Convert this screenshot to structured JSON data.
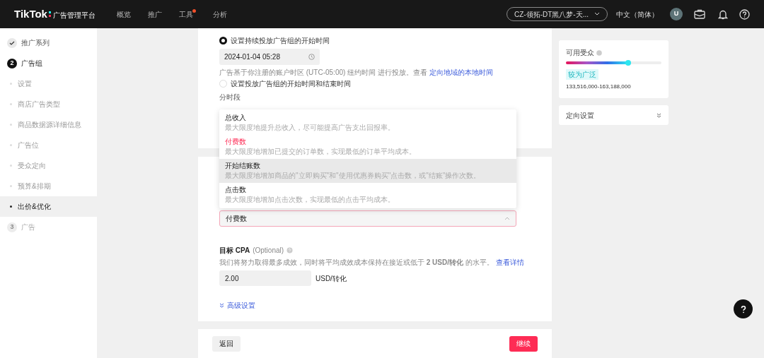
{
  "header": {
    "logo": "TikTok",
    "logo_suffix": "广告管理平台",
    "nav": [
      {
        "label": "概览",
        "badge": false
      },
      {
        "label": "推广",
        "badge": false
      },
      {
        "label": "工具",
        "badge": true
      },
      {
        "label": "分析",
        "badge": false
      }
    ],
    "account": "CZ-领拓-DT黑八梦-天...",
    "language": "中文（简体）",
    "avatar": "U"
  },
  "sidebar": [
    {
      "kind": "step",
      "done": true,
      "current": false,
      "label": "推广系列"
    },
    {
      "kind": "step",
      "done": false,
      "current": true,
      "number": "2",
      "label": "广告组"
    },
    {
      "kind": "sub",
      "label": "设置",
      "selected": false
    },
    {
      "kind": "sub",
      "label": "商店广告类型",
      "selected": false
    },
    {
      "kind": "sub",
      "label": "商品数据源详细信息",
      "selected": false
    },
    {
      "kind": "sub",
      "label": "广告位",
      "selected": false
    },
    {
      "kind": "sub",
      "label": "受众定向",
      "selected": false
    },
    {
      "kind": "sub",
      "label": "预算&排期",
      "selected": false
    },
    {
      "kind": "sub",
      "label": "出价&优化",
      "selected": true
    },
    {
      "kind": "step",
      "done": false,
      "current": false,
      "number": "3",
      "label": "广告"
    }
  ],
  "schedule": {
    "options": [
      {
        "label": "设置持续投放广告组的开始时间",
        "selected": true
      },
      {
        "label": "设置投放广告组的开始时间和结束时间",
        "selected": false
      }
    ],
    "start_time": "2024-01-04 05:28",
    "note": "广告基于你注册的账户时区 (UTC-05:00) 纽约时间 进行投放。查看",
    "note_link": "定向地域的本地时间",
    "dayparting_label": "分时段"
  },
  "optimization": {
    "dropdown": [
      {
        "label": "总收入",
        "description": "最大限度地提升总收入，尽可能提高广告支出回报率。",
        "selected": false,
        "highlighted": false
      },
      {
        "label": "付费数",
        "description": "最大限度地增加已提交的订单数，实现最低的订单平均成本。",
        "selected": true,
        "highlighted": false
      },
      {
        "label": "开始结账数",
        "description": "最大限度地增加商品的\"立即购买\"和\"使用优惠券购买\"点击数，或\"结账\"操作次数。",
        "selected": false,
        "highlighted": true
      },
      {
        "label": "点击数",
        "description": "最大限度地增加点击次数，实现最低的点击平均成本。",
        "selected": false,
        "highlighted": false
      }
    ],
    "value": "付费数",
    "cpa_label": "目标 CPA",
    "cpa_optional": "(Optional)",
    "cpa_description": "我们将努力取得最多成效，同时将平均成效成本保持在接近或低于 **2 USD/转化** 的水平。",
    "cpa_link": "查看详情",
    "cpa_value": "2.00",
    "cpa_unit": "USD/转化",
    "advanced": "高级设置"
  },
  "footer": {
    "back": "返回",
    "continue": "继续"
  },
  "audience": {
    "title": "可用受众",
    "level": 0.65,
    "tag": "较为广泛",
    "range": "133,516,000-163,188,000"
  },
  "targeting": {
    "title": "定向设置"
  }
}
